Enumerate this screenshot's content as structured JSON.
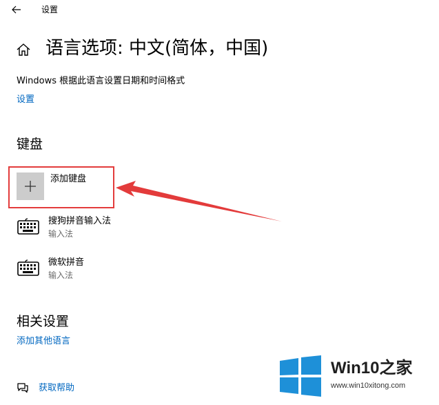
{
  "window": {
    "title": "设置"
  },
  "header": {
    "title": "语言选项: 中文(简体，中国)"
  },
  "regional": {
    "description": "Windows 根据此语言设置日期和时间格式",
    "settings_link": "设置"
  },
  "keyboard": {
    "heading": "键盘",
    "add_label": "添加键盘",
    "items": [
      {
        "name": "搜狗拼音输入法",
        "type": "输入法"
      },
      {
        "name": "微软拼音",
        "type": "输入法"
      }
    ]
  },
  "related": {
    "heading": "相关设置",
    "add_language_link": "添加其他语言"
  },
  "help": {
    "label": "获取帮助"
  },
  "watermark": {
    "brand": "Win10之家",
    "url": "www.win10xitong.com"
  },
  "colors": {
    "link": "#0067c0",
    "annotation": "#e33b3b",
    "tile": "#cccccc",
    "logo": "#1e90d8"
  },
  "icons": {
    "back": "back-arrow-icon",
    "home": "home-icon",
    "add": "plus-icon",
    "keyboard": "keyboard-icon",
    "help": "chat-help-icon",
    "logo": "windows-logo-icon"
  }
}
